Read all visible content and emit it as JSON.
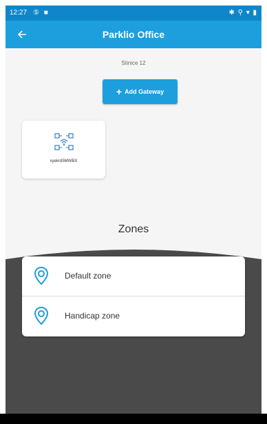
{
  "status_bar": {
    "time": "12:27",
    "left_icons": "⑤ ■",
    "right_icons": "✱ ⚲ ▾ ▮"
  },
  "app_bar": {
    "back_icon": "arrow-back-icon",
    "title": "Parklio Office"
  },
  "location": {
    "subtitle": "Stinice 12"
  },
  "add_gateway": {
    "plus": "+",
    "label": "Add Gateway"
  },
  "gateways": [
    {
      "icon": "gateway-icon",
      "name": "xyekrd5MWBX"
    }
  ],
  "zones": {
    "title": "Zones",
    "items": [
      {
        "icon": "location-pin-icon",
        "label": "Default zone"
      },
      {
        "icon": "location-pin-icon",
        "label": "Handicap zone"
      }
    ]
  },
  "colors": {
    "status_bar": "#0f86c9",
    "app_bar": "#1d9fde",
    "accent": "#1d9fde",
    "background": "#f5f5f5",
    "dark_section": "#4a4a4a"
  }
}
